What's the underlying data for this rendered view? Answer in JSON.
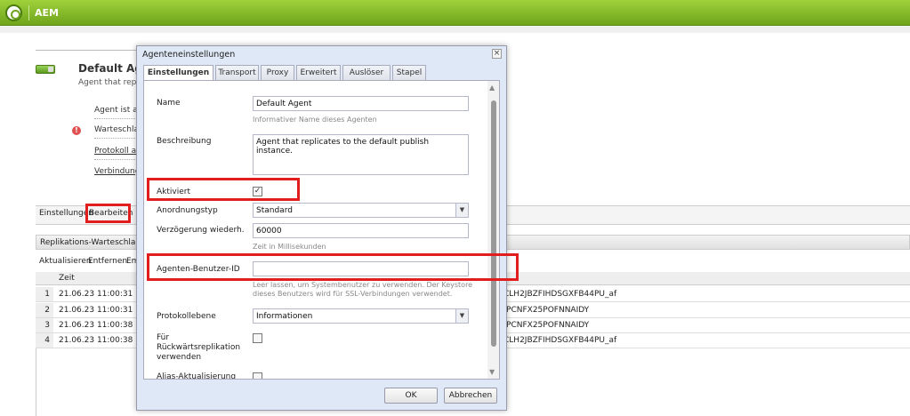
{
  "app": {
    "title": "AEM"
  },
  "page": {
    "agent_title": "Default Agen",
    "agent_sub": "Agent that repli",
    "lines": [
      "Agent ist ak",
      "Warteschlan",
      "Protokoll an",
      "Verbindung"
    ],
    "toolbar": {
      "settings": "Einstellungen",
      "edit": "Bearbeiten"
    },
    "queue_header": "Replikations-Warteschlange",
    "queue_actions": [
      "Aktualisieren",
      "Entfernen",
      "Em"
    ],
    "grid": {
      "col_time": "Zeit",
      "rows": [
        {
          "num": "1",
          "time": "21.06.23 11:00:31",
          "rest": "CLH2JBZFIHDSGXFB44PU_af"
        },
        {
          "num": "2",
          "time": "21.06.23 11:00:31",
          "rest": "/PCNFX25POFNNAIDY"
        },
        {
          "num": "3",
          "time": "21.06.23 11:00:38",
          "rest": "/PCNFX25POFNNAIDY"
        },
        {
          "num": "4",
          "time": "21.06.23 11:00:38",
          "rest": "CLH2JBZFIHDSGXFB44PU_af"
        }
      ]
    }
  },
  "dialog": {
    "title": "Agenteneinstellungen",
    "close": "×",
    "tabs": [
      "Einstellungen",
      "Transport",
      "Proxy",
      "Erweitert",
      "Auslöser",
      "Stapel"
    ],
    "fields": {
      "name_label": "Name",
      "name_value": "Default Agent",
      "name_hint": "Informativer Name dieses Agenten",
      "desc_label": "Beschreibung",
      "desc_value": "Agent that replicates to the default publish instance.",
      "enabled_label": "Aktiviert",
      "enabled_check": "✓",
      "serial_label": "Anordnungstyp",
      "serial_value": "Standard",
      "retry_label": "Verzögerung wiederh.",
      "retry_value": "60000",
      "retry_hint": "Zeit in Millisekunden",
      "userid_label": "Agenten-Benutzer-ID",
      "userid_value": "",
      "userid_hint1": "Leer lassen, um Systembenutzer zu verwenden. Der Keystore",
      "userid_hint2": "dieses Benutzers wird für SSL-Verbindungen verwendet.",
      "loglevel_label": "Protokollebene",
      "loglevel_value": "Informationen",
      "reverse_label1": "Für",
      "reverse_label2": "Rückwärtsreplikation",
      "reverse_label3": "verwenden",
      "alias_label": "Alias-Aktualisierung"
    },
    "ok": "OK",
    "cancel": "Abbrechen"
  }
}
